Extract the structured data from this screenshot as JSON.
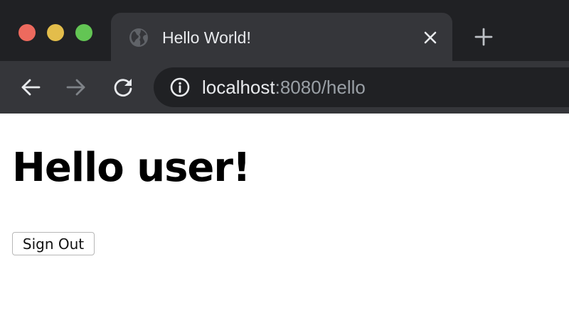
{
  "window": {
    "controls": {
      "close_color": "#ed6a5e",
      "minimize_color": "#e3bd4b",
      "maximize_color": "#63c554"
    }
  },
  "tab": {
    "title": "Hello World!",
    "favicon": "globe-icon",
    "close_icon": "close-icon"
  },
  "new_tab_icon": "plus-icon",
  "toolbar": {
    "back_icon": "back-arrow-icon",
    "forward_icon": "forward-arrow-icon",
    "reload_icon": "reload-icon",
    "site_info_icon": "info-icon",
    "url_host": "localhost",
    "url_rest": ":8080/hello"
  },
  "page": {
    "heading": "Hello user!",
    "signout_label": "Sign Out"
  }
}
